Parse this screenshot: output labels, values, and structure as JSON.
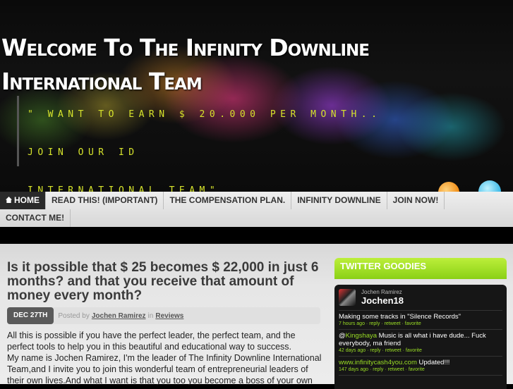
{
  "header": {
    "title": "Welcome To The Infinity Downline International Team",
    "tagline_line1": "\" Want to earn $ 20.000 per month.. Join our ID",
    "tagline_line2": "International Team\""
  },
  "nav": {
    "row1": [
      "HOME",
      "READ THIS! (IMPORTANT)",
      "THE COMPENSATION PLAN.",
      "INFINITY DOWNLINE",
      "JOIN NOW!"
    ],
    "row2": [
      "CONTACT ME!"
    ]
  },
  "post": {
    "title": "Is it possible that $ 25 becomes $ 22,000 in just 6 months? and that you receive that amount of money every month?",
    "date": "DEC 27TH",
    "posted_by_label": "Posted by",
    "author": "Jochen Ramirez",
    "in_label": "in",
    "category": "Reviews",
    "paragraphs": [
      "All this is possible if you have the perfect leader, the perfect team, and the perfect tools to help you in this beautiful and educational way to success.",
      "My name is Jochen Ramirez, I'm the leader of The Infinity Downline International Team,and I invite you to join this wonderful team of entrepreneurial leaders of their own lives.And what I want is that you too you become a boss of your own"
    ]
  },
  "sidebar": {
    "twitter_title": "TWITTER GOODIES",
    "profile_name": "Jochen Ramirez",
    "profile_handle": "Jochen18",
    "tweets": [
      {
        "pre": "",
        "link": "",
        "text": "Making some tracks in \"Silence Records\"",
        "meta": "7 hours ago · reply · retweet · favorite"
      },
      {
        "pre": "@",
        "link": "Kingshaya",
        "text": " Music is all what i have dude... Fuck everybody, ma friend",
        "meta": "42 days ago · reply · retweet · favorite"
      },
      {
        "pre": "",
        "link": "www.infinitycash4you.com",
        "text": " Updated!!!",
        "meta": "147 days ago · reply · retweet · favorite"
      }
    ]
  },
  "colors": {
    "accent": "#9ade25",
    "tagline": "#d6e32c"
  }
}
